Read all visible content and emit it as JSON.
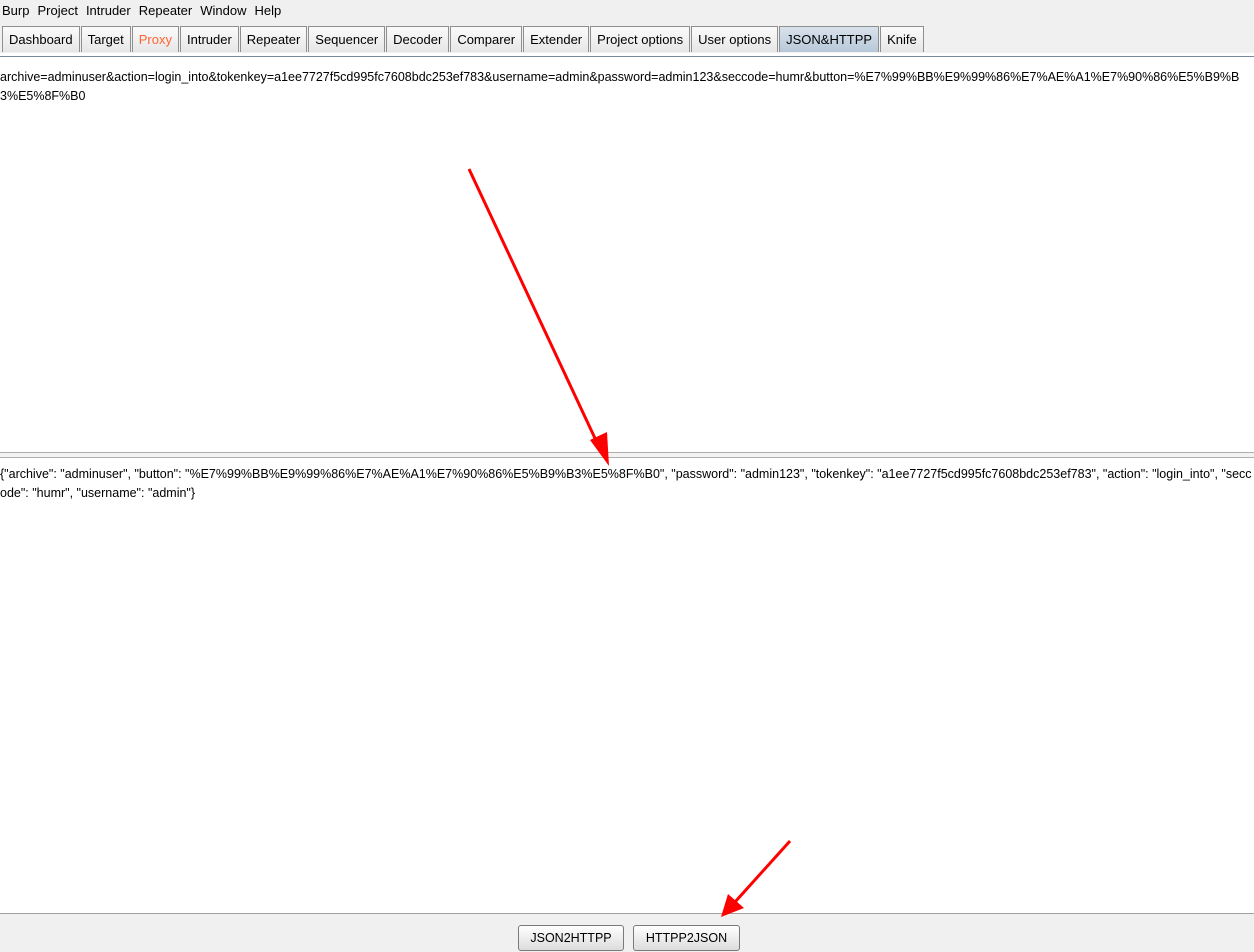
{
  "menubar": {
    "items": [
      "Burp",
      "Project",
      "Intruder",
      "Repeater",
      "Window",
      "Help"
    ]
  },
  "tabs": [
    {
      "label": "Dashboard"
    },
    {
      "label": "Target"
    },
    {
      "label": "Proxy"
    },
    {
      "label": "Intruder"
    },
    {
      "label": "Repeater"
    },
    {
      "label": "Sequencer"
    },
    {
      "label": "Decoder"
    },
    {
      "label": "Comparer"
    },
    {
      "label": "Extender"
    },
    {
      "label": "Project options"
    },
    {
      "label": "User options"
    },
    {
      "label": "JSON&HTTPP"
    },
    {
      "label": "Knife"
    }
  ],
  "active_tab": "JSON&HTTPP",
  "highlight_tab": "Proxy",
  "editor": {
    "http_text": "archive=adminuser&action=login_into&tokenkey=a1ee7727f5cd995fc7608bdc253ef783&username=admin&password=admin123&seccode=humr&button=%E7%99%BB%E9%99%86%E7%AE%A1%E7%90%86%E5%B9%B3%E5%8F%B0",
    "json_text": "{\"archive\": \"adminuser\", \"button\": \"%E7%99%BB%E9%99%86%E7%AE%A1%E7%90%86%E5%B9%B3%E5%8F%B0\", \"password\": \"admin123\", \"tokenkey\": \"a1ee7727f5cd995fc7608bdc253ef783\", \"action\": \"login_into\", \"seccode\": \"humr\", \"username\": \"admin\"}"
  },
  "buttons": {
    "json2http": "JSON2HTTPP",
    "http2json": "HTTPP2JSON"
  },
  "colors": {
    "arrow": "#ff0000",
    "proxy_tab_text": "#ff6633"
  }
}
